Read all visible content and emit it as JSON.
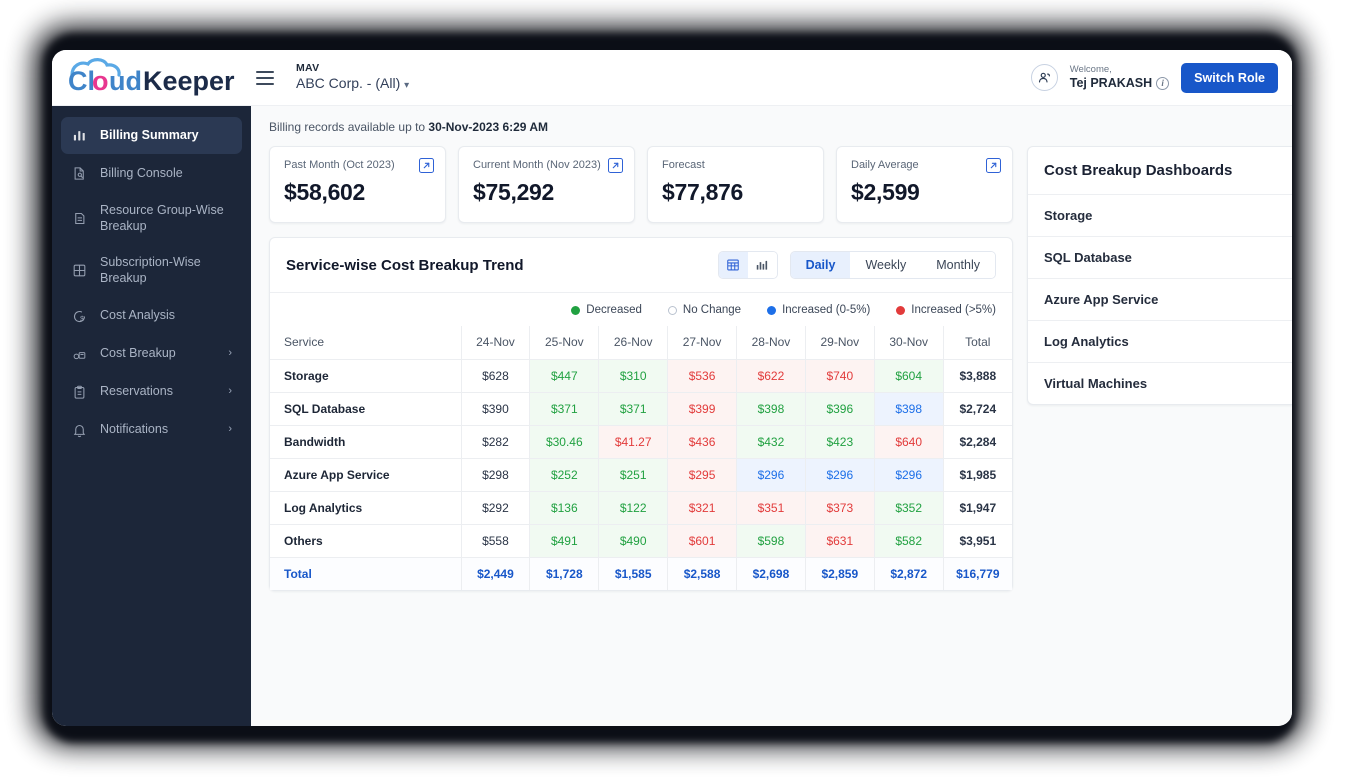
{
  "brand": {
    "logo_text_1": "Cl",
    "logo_text_o": "o",
    "logo_text_2": "ud",
    "logo_text_3": "Keeper"
  },
  "topbar": {
    "menu_icon": "hamburger-icon",
    "account_tag": "MAV",
    "account_name": "ABC Corp. - (All)",
    "caret": "▾",
    "welcome_label": "Welcome,",
    "user_name": "Tej PRAKASH",
    "info_icon": "i",
    "switch_role_label": "Switch Role"
  },
  "sidebar": {
    "items": [
      {
        "label": "Billing Summary",
        "icon": "bar-chart-icon",
        "active": true,
        "chevron": ""
      },
      {
        "label": "Billing Console",
        "icon": "document-search-icon",
        "active": false,
        "chevron": ""
      },
      {
        "label": "Resource Group-Wise Breakup",
        "icon": "resource-group-icon",
        "active": false,
        "chevron": ""
      },
      {
        "label": "Subscription-Wise Breakup",
        "icon": "grid-icon",
        "active": false,
        "chevron": ""
      },
      {
        "label": "Cost Analysis",
        "icon": "cost-analysis-icon",
        "active": false,
        "chevron": ""
      },
      {
        "label": "Cost Breakup",
        "icon": "coins-icon",
        "active": false,
        "chevron": "›"
      },
      {
        "label": "Reservations",
        "icon": "clipboard-icon",
        "active": false,
        "chevron": "›"
      },
      {
        "label": "Notifications",
        "icon": "bell-icon",
        "active": false,
        "chevron": "›"
      }
    ]
  },
  "main": {
    "records_prefix": "Billing records available up to ",
    "records_date": "30-Nov-2023 6:29 AM",
    "kpi_cards": [
      {
        "label": "Past Month (Oct 2023)",
        "value": "$58,602",
        "has_link": true
      },
      {
        "label": "Current Month (Nov 2023)",
        "value": "$75,292",
        "has_link": true
      },
      {
        "label": "Forecast",
        "value": "$77,876",
        "has_link": false
      },
      {
        "label": "Daily Average",
        "value": "$2,599",
        "has_link": true
      }
    ],
    "panel": {
      "title": "Service-wise Cost Breakup Trend",
      "view_toggle": [
        {
          "icon": "table-view-icon",
          "active": true
        },
        {
          "icon": "chart-view-icon",
          "active": false
        }
      ],
      "period_tabs": [
        {
          "label": "Daily",
          "active": true
        },
        {
          "label": "Weekly",
          "active": false
        },
        {
          "label": "Monthly",
          "active": false
        }
      ],
      "legend": [
        {
          "label": "Decreased",
          "color": "#21a141",
          "style": "solid"
        },
        {
          "label": "No Change",
          "color": "#b9c2cf",
          "style": "hollow"
        },
        {
          "label": "Increased (0-5%)",
          "color": "#1d6fe8",
          "style": "solid"
        },
        {
          "label": "Increased (>5%)",
          "color": "#e23b3b",
          "style": "solid"
        }
      ]
    }
  },
  "chart_data": {
    "type": "table",
    "title": "Service-wise Cost Breakup Trend",
    "columns": [
      "Service",
      "24-Nov",
      "25-Nov",
      "26-Nov",
      "27-Nov",
      "28-Nov",
      "29-Nov",
      "30-Nov",
      "Total"
    ],
    "rows": [
      {
        "service": "Storage",
        "cells": [
          {
            "v": "$628",
            "s": "n"
          },
          {
            "v": "$447",
            "s": "g"
          },
          {
            "v": "$310",
            "s": "g"
          },
          {
            "v": "$536",
            "s": "r"
          },
          {
            "v": "$622",
            "s": "r"
          },
          {
            "v": "$740",
            "s": "r"
          },
          {
            "v": "$604",
            "s": "g"
          },
          {
            "v": "$3,888",
            "s": "tot"
          }
        ]
      },
      {
        "service": "SQL Database",
        "cells": [
          {
            "v": "$390",
            "s": "n"
          },
          {
            "v": "$371",
            "s": "g"
          },
          {
            "v": "$371",
            "s": "g"
          },
          {
            "v": "$399",
            "s": "r"
          },
          {
            "v": "$398",
            "s": "g"
          },
          {
            "v": "$396",
            "s": "g"
          },
          {
            "v": "$398",
            "s": "b"
          },
          {
            "v": "$2,724",
            "s": "tot"
          }
        ]
      },
      {
        "service": "Bandwidth",
        "cells": [
          {
            "v": "$282",
            "s": "n"
          },
          {
            "v": "$30.46",
            "s": "g"
          },
          {
            "v": "$41.27",
            "s": "r"
          },
          {
            "v": "$436",
            "s": "r"
          },
          {
            "v": "$432",
            "s": "g"
          },
          {
            "v": "$423",
            "s": "g"
          },
          {
            "v": "$640",
            "s": "r"
          },
          {
            "v": "$2,284",
            "s": "tot"
          }
        ]
      },
      {
        "service": "Azure App Service",
        "cells": [
          {
            "v": "$298",
            "s": "n"
          },
          {
            "v": "$252",
            "s": "g"
          },
          {
            "v": "$251",
            "s": "g"
          },
          {
            "v": "$295",
            "s": "r"
          },
          {
            "v": "$296",
            "s": "b"
          },
          {
            "v": "$296",
            "s": "b"
          },
          {
            "v": "$296",
            "s": "b"
          },
          {
            "v": "$1,985",
            "s": "tot"
          }
        ]
      },
      {
        "service": "Log Analytics",
        "cells": [
          {
            "v": "$292",
            "s": "n"
          },
          {
            "v": "$136",
            "s": "g"
          },
          {
            "v": "$122",
            "s": "g"
          },
          {
            "v": "$321",
            "s": "r"
          },
          {
            "v": "$351",
            "s": "r"
          },
          {
            "v": "$373",
            "s": "r"
          },
          {
            "v": "$352",
            "s": "g"
          },
          {
            "v": "$1,947",
            "s": "tot"
          }
        ]
      },
      {
        "service": "Others",
        "cells": [
          {
            "v": "$558",
            "s": "n"
          },
          {
            "v": "$491",
            "s": "g"
          },
          {
            "v": "$490",
            "s": "g"
          },
          {
            "v": "$601",
            "s": "r"
          },
          {
            "v": "$598",
            "s": "g"
          },
          {
            "v": "$631",
            "s": "r"
          },
          {
            "v": "$582",
            "s": "g"
          },
          {
            "v": "$3,951",
            "s": "tot"
          }
        ]
      }
    ],
    "total_row": {
      "service": "Total",
      "cells": [
        "$2,449",
        "$1,728",
        "$1,585",
        "$2,588",
        "$2,698",
        "$2,859",
        "$2,872",
        "$16,779"
      ]
    },
    "legend_entries": [
      "Decreased",
      "No Change",
      "Increased (0-5%)",
      "Increased (>5%)"
    ],
    "colors": {
      "decreased": "#21a141",
      "no_change": "#b9c2cf",
      "increased_small": "#1d6fe8",
      "increased_large": "#e23b3b",
      "accent": "#1857c9"
    }
  },
  "dashboards": {
    "title": "Cost Breakup Dashboards",
    "items": [
      "Storage",
      "SQL Database",
      "Azure App Service",
      "Log Analytics",
      "Virtual Machines"
    ]
  }
}
